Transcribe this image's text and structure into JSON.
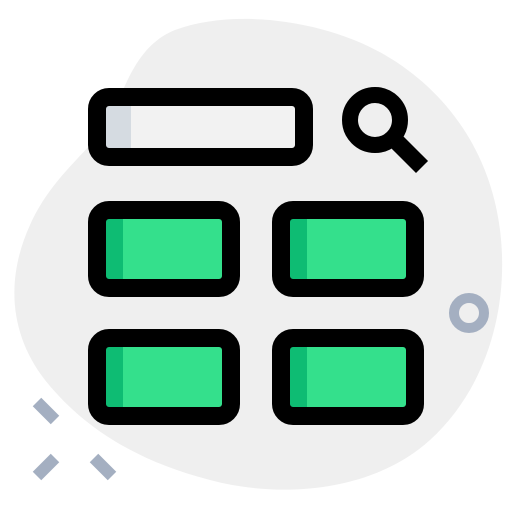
{
  "icon": {
    "name": "search-grid-icon",
    "parts": {
      "search_bar": "search-bar-icon",
      "magnifier": "magnifier-icon",
      "tiles": [
        "grid-tile-icon",
        "grid-tile-icon",
        "grid-tile-icon",
        "grid-tile-icon"
      ]
    }
  },
  "colors": {
    "blob": "#efefef",
    "outline": "#000000",
    "search_fill": "#f2f2f2",
    "search_accent": "#d5dbe1",
    "tile_fill": "#34e08c",
    "tile_accent": "#0ebc73",
    "decor": "#a4afc1"
  }
}
